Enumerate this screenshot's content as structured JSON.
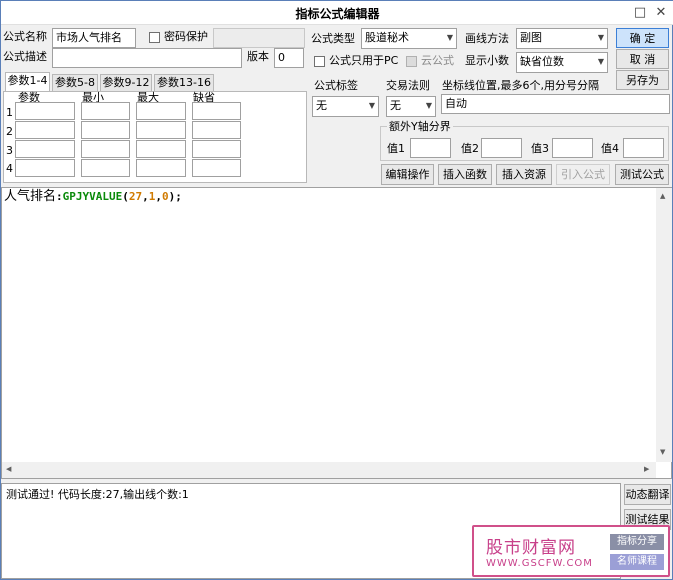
{
  "window": {
    "title": "指标公式编辑器",
    "maximize_icon": "□",
    "close_icon": "✕"
  },
  "form": {
    "name_label": "公式名称",
    "name_value": "市场人气排名",
    "password_label": "密码保护",
    "desc_label": "公式描述",
    "desc_value": "",
    "version_label": "版本",
    "version_value": "0",
    "type_label": "公式类型",
    "type_value": "股道秘术",
    "draw_label": "画线方法",
    "draw_value": "副图",
    "pc_only_label": "公式只用于PC",
    "cloud_label": "云公式",
    "decimals_label": "显示小数",
    "decimals_value": "缺省位数",
    "tag_label": "公式标签",
    "tag_value": "无",
    "rule_label": "交易法则",
    "rule_value": "无",
    "coord_label": "坐标线位置,最多6个,用分号分隔",
    "coord_value": "自动",
    "yaxis_group_label": "额外Y轴分界",
    "yaxis_values": [
      {
        "label": "值1",
        "value": ""
      },
      {
        "label": "值2",
        "value": ""
      },
      {
        "label": "值3",
        "value": ""
      },
      {
        "label": "值4",
        "value": ""
      }
    ]
  },
  "params": {
    "tabs": [
      "参数1-4",
      "参数5-8",
      "参数9-12",
      "参数13-16"
    ],
    "headers": [
      "参数",
      "最小",
      "最大",
      "缺省"
    ],
    "rows": [
      "1",
      "2",
      "3",
      "4"
    ]
  },
  "buttons": {
    "ok": "确  定",
    "cancel": "取  消",
    "save_as": "另存为",
    "edit_ops": "编辑操作",
    "insert_func": "插入函数",
    "insert_res": "插入资源",
    "import_formula": "引入公式",
    "test_formula": "测试公式",
    "dynamic_translate": "动态翻译",
    "test_result": "测试结果"
  },
  "editor": {
    "code_name": "人气排名",
    "code_sep": ":",
    "code_func": "GPJYVALUE",
    "code_open": "(",
    "arg1": "27",
    "comma1": ",",
    "arg2": "1",
    "comma2": ",",
    "arg3": "0",
    "code_close": ");"
  },
  "status_text": "测试通过! 代码长度:27,输出线个数:1",
  "watermark": {
    "title": "股市财富网",
    "url": "WWW.GSCFW.COM",
    "tag1": "指标分享",
    "tag2": "名师课程"
  }
}
